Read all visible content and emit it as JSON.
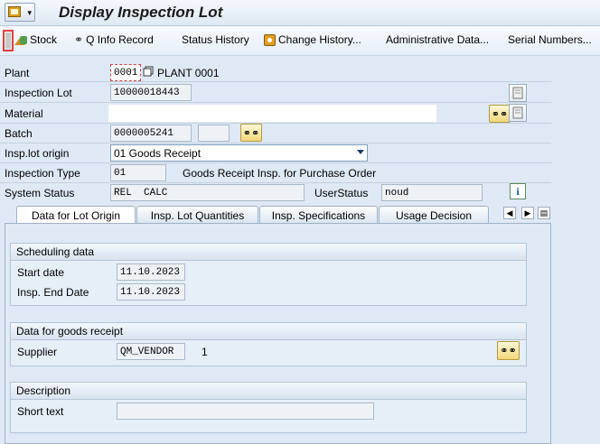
{
  "window": {
    "title": "Display Inspection Lot"
  },
  "toolbar": {
    "stock": "Stock",
    "q_info": "Q Info Record",
    "status_history": "Status History",
    "change_history": "Change History...",
    "admin_data": "Administrative Data...",
    "serial_numbers": "Serial Numbers..."
  },
  "header": {
    "plant_label": "Plant",
    "plant_value": "0001",
    "plant_name": "PLANT 0001",
    "lot_label": "Inspection Lot",
    "lot_value": "10000018443",
    "material_label": "Material",
    "material_value": "",
    "batch_label": "Batch",
    "batch_value": "0000005241",
    "batch_extra": "",
    "origin_label": "Insp.lot origin",
    "origin_value": "01 Goods Receipt",
    "type_label": "Inspection Type",
    "type_value": "01",
    "type_desc": "Goods Receipt Insp. for Purchase Order",
    "sys_status_label": "System Status",
    "sys_status_value": "REL  CALC",
    "user_status_label": "UserStatus",
    "user_status_value": "noud",
    "info_icon": "i"
  },
  "tabs": [
    {
      "label": "Data for Lot Origin"
    },
    {
      "label": "Insp. Lot Quantities"
    },
    {
      "label": "Insp. Specifications"
    },
    {
      "label": "Usage Decision"
    }
  ],
  "scheduling": {
    "title": "Scheduling data",
    "start_label": "Start date",
    "start_value": "11.10.2023",
    "end_label": "Insp. End Date",
    "end_value": "11.10.2023"
  },
  "goods_receipt": {
    "title": "Data for goods receipt",
    "supplier_label": "Supplier",
    "supplier_value": "QM_VENDOR",
    "supplier_extra": "1"
  },
  "description": {
    "title": "Description",
    "short_text_label": "Short text",
    "short_text_value": ""
  },
  "colors": {
    "accent": "#1d3a6a",
    "background": "#dfe9f5",
    "highlight": "#e04040"
  }
}
